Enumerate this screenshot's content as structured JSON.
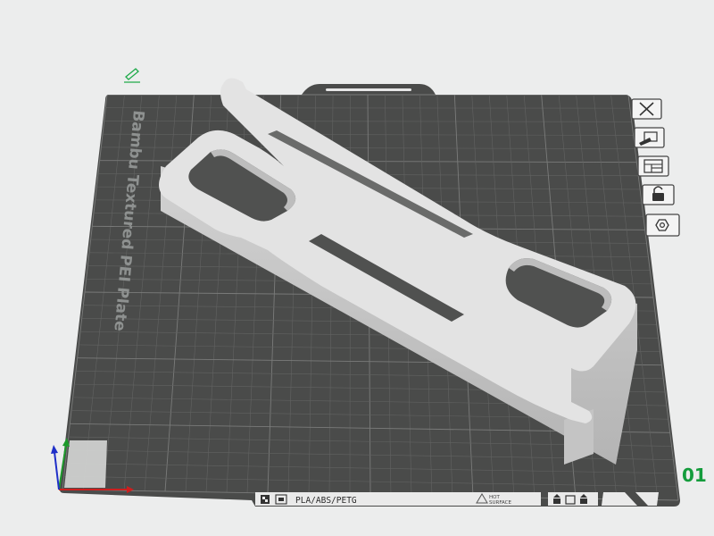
{
  "plate": {
    "name": "Bambu Textured PEI Plate",
    "number": "01"
  },
  "bottom_strip": {
    "filament_types": "PLA/ABS/PETG",
    "warning_line1": "HOT",
    "warning_line2": "SURFACE"
  },
  "plate_toolbar": {
    "buttons": [
      "close",
      "pick-plate",
      "arrange",
      "lock",
      "settings"
    ]
  },
  "colors": {
    "background": "#eceded",
    "plate": "#4a4b4a",
    "grid": "#6c6d6c",
    "model": "#e3e3e3",
    "plate_number": "#149c3c",
    "edit_icon": "#1faa4a"
  }
}
